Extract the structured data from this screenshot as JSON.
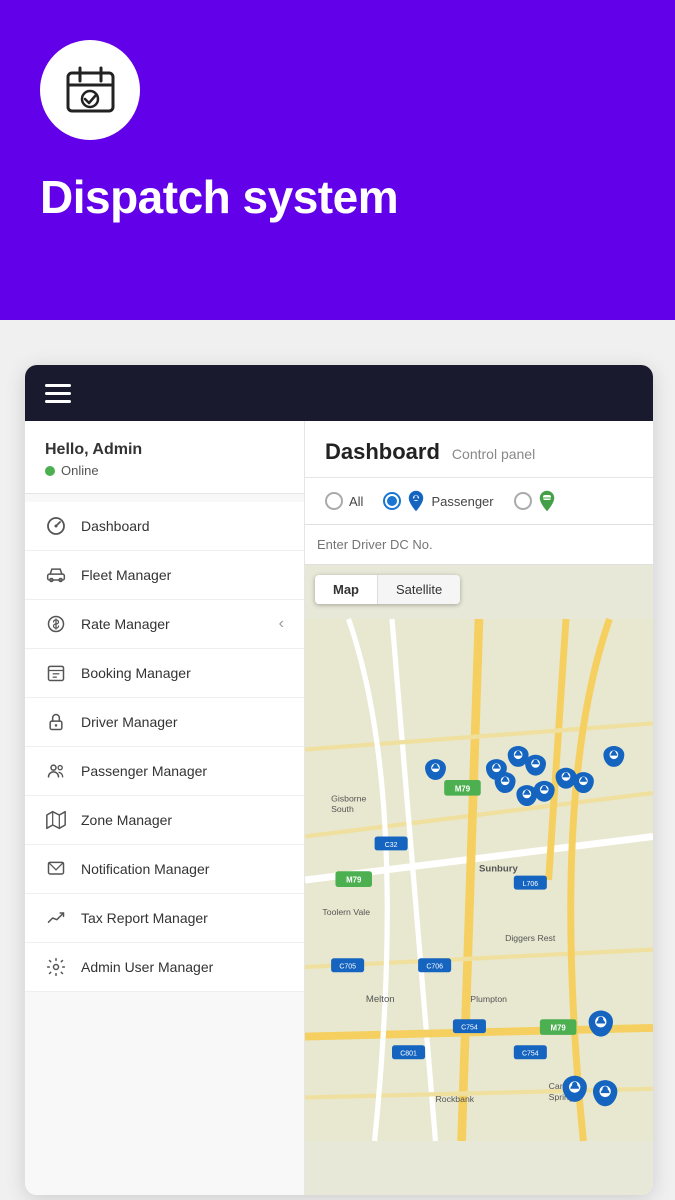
{
  "header": {
    "logo_icon": "calendar-check-icon",
    "title": "Dispatch system"
  },
  "sidebar": {
    "user": {
      "greeting": "Hello, Admin",
      "status": "Online"
    },
    "nav_items": [
      {
        "id": "dashboard",
        "label": "Dashboard",
        "icon": "dashboard-icon",
        "active": true
      },
      {
        "id": "fleet-manager",
        "label": "Fleet Manager",
        "icon": "car-icon",
        "active": false
      },
      {
        "id": "rate-manager",
        "label": "Rate Manager",
        "icon": "dollar-icon",
        "active": false,
        "has_chevron": true
      },
      {
        "id": "booking-manager",
        "label": "Booking Manager",
        "icon": "booking-icon",
        "active": false
      },
      {
        "id": "driver-manager",
        "label": "Driver Manager",
        "icon": "lock-icon",
        "active": false
      },
      {
        "id": "passenger-manager",
        "label": "Passenger Manager",
        "icon": "people-icon",
        "active": false
      },
      {
        "id": "zone-manager",
        "label": "Zone Manager",
        "icon": "map-icon",
        "active": false
      },
      {
        "id": "notification-manager",
        "label": "Notification Manager",
        "icon": "notification-icon",
        "active": false
      },
      {
        "id": "tax-report-manager",
        "label": "Tax Report Manager",
        "icon": "chart-icon",
        "active": false
      },
      {
        "id": "admin-user-manager",
        "label": "Admin User Manager",
        "icon": "settings-icon",
        "active": false
      }
    ]
  },
  "dashboard": {
    "title": "Dashboard",
    "subtitle": "Control panel",
    "filter": {
      "all_label": "All",
      "passenger_label": "Passenger",
      "selected": "passenger"
    },
    "search": {
      "placeholder": "Enter Driver DC No."
    },
    "map": {
      "view_options": [
        "Map",
        "Satellite"
      ],
      "active_view": "Map"
    }
  },
  "topbar": {
    "menu_icon": "hamburger-icon"
  }
}
